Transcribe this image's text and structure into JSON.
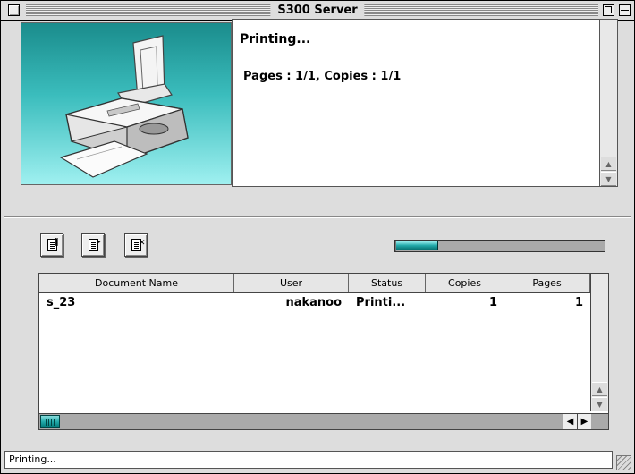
{
  "window": {
    "title": "S300 Server"
  },
  "status_panel": {
    "status": "Printing...",
    "detail": "Pages : 1/1, Copies : 1/1"
  },
  "toolbar": {
    "pause_icon": "pause-document-icon",
    "resume_icon": "resume-document-icon",
    "delete_icon": "delete-document-icon"
  },
  "progress": {
    "fraction": 0.2,
    "color": "#22aaaa"
  },
  "queue": {
    "columns": [
      "Document Name",
      "User",
      "Status",
      "Copies",
      "Pages"
    ],
    "rows": [
      {
        "document_name": "s_23",
        "user": "nakanoo",
        "status": "Printi...",
        "copies": "1",
        "pages": "1"
      }
    ]
  },
  "statusbar": {
    "text": "Printing..."
  },
  "colors": {
    "accent": "#22aaaa",
    "image_top": "#1a8c8c",
    "image_bottom": "#9ff0f0"
  }
}
